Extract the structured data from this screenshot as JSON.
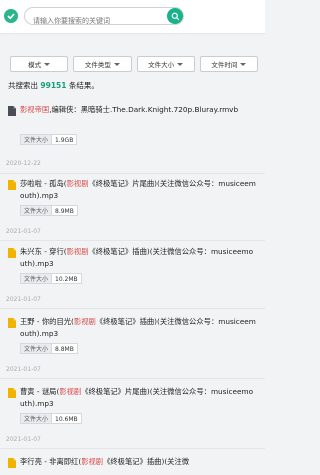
{
  "search": {
    "placeholder": "请输入你要搜索的关键词"
  },
  "filters": [
    {
      "label": "模式"
    },
    {
      "label": "文件类型"
    },
    {
      "label": "文件大小"
    },
    {
      "label": "文件时间"
    }
  ],
  "summary": {
    "prefix": "共搜索出",
    "count": "99151",
    "suffix": "条结果。"
  },
  "results": [
    {
      "icon": "video-file-icon",
      "highlight": "影视帝国",
      "rest": ",编辑侠：黑暗骑士.The.Dark.Knight.720p.Bluray.rmvb",
      "size_label": "文件大小",
      "size": "1.9GB",
      "date": "2020-12-22"
    },
    {
      "icon": "audio-file-icon",
      "before": "莎啦啦 - 孤岛(",
      "highlight": "影视剧",
      "after": "《终极笔记》片尾曲)(关注微信公众号：musiceemouth).mp3",
      "size_label": "文件大小",
      "size": "8.9MB",
      "date": "2021-01-07"
    },
    {
      "icon": "audio-file-icon",
      "before": "朱兴东 - 穿行(",
      "highlight": "影视剧",
      "after": "《终极笔记》插曲)(关注微信公众号：musiceemouth).mp3",
      "size_label": "文件大小",
      "size": "10.2MB",
      "date": "2021-01-07"
    },
    {
      "icon": "audio-file-icon",
      "before": "王野 - 你的目光(",
      "highlight": "影视剧",
      "after": "《终极笔记》插曲)(关注微信公众号：musiceemouth).mp3",
      "size_label": "文件大小",
      "size": "8.8MB",
      "date": "2021-01-07"
    },
    {
      "icon": "audio-file-icon",
      "before": "曹寅 - 谜局(",
      "highlight": "影视剧",
      "after": "《终极笔记》片尾曲)(关注微信公众号：musiceemouth).mp3",
      "size_label": "文件大小",
      "size": "10.6MB",
      "date": "2021-01-07"
    },
    {
      "icon": "audio-file-icon",
      "before": "李行亮 - 非离即红(",
      "highlight": "影视剧",
      "after": "《终极笔记》插曲)(关注微"
    }
  ],
  "colors": {
    "accent": "#19b28a",
    "highlight": "#d94a4a",
    "count": "#13a07a"
  }
}
